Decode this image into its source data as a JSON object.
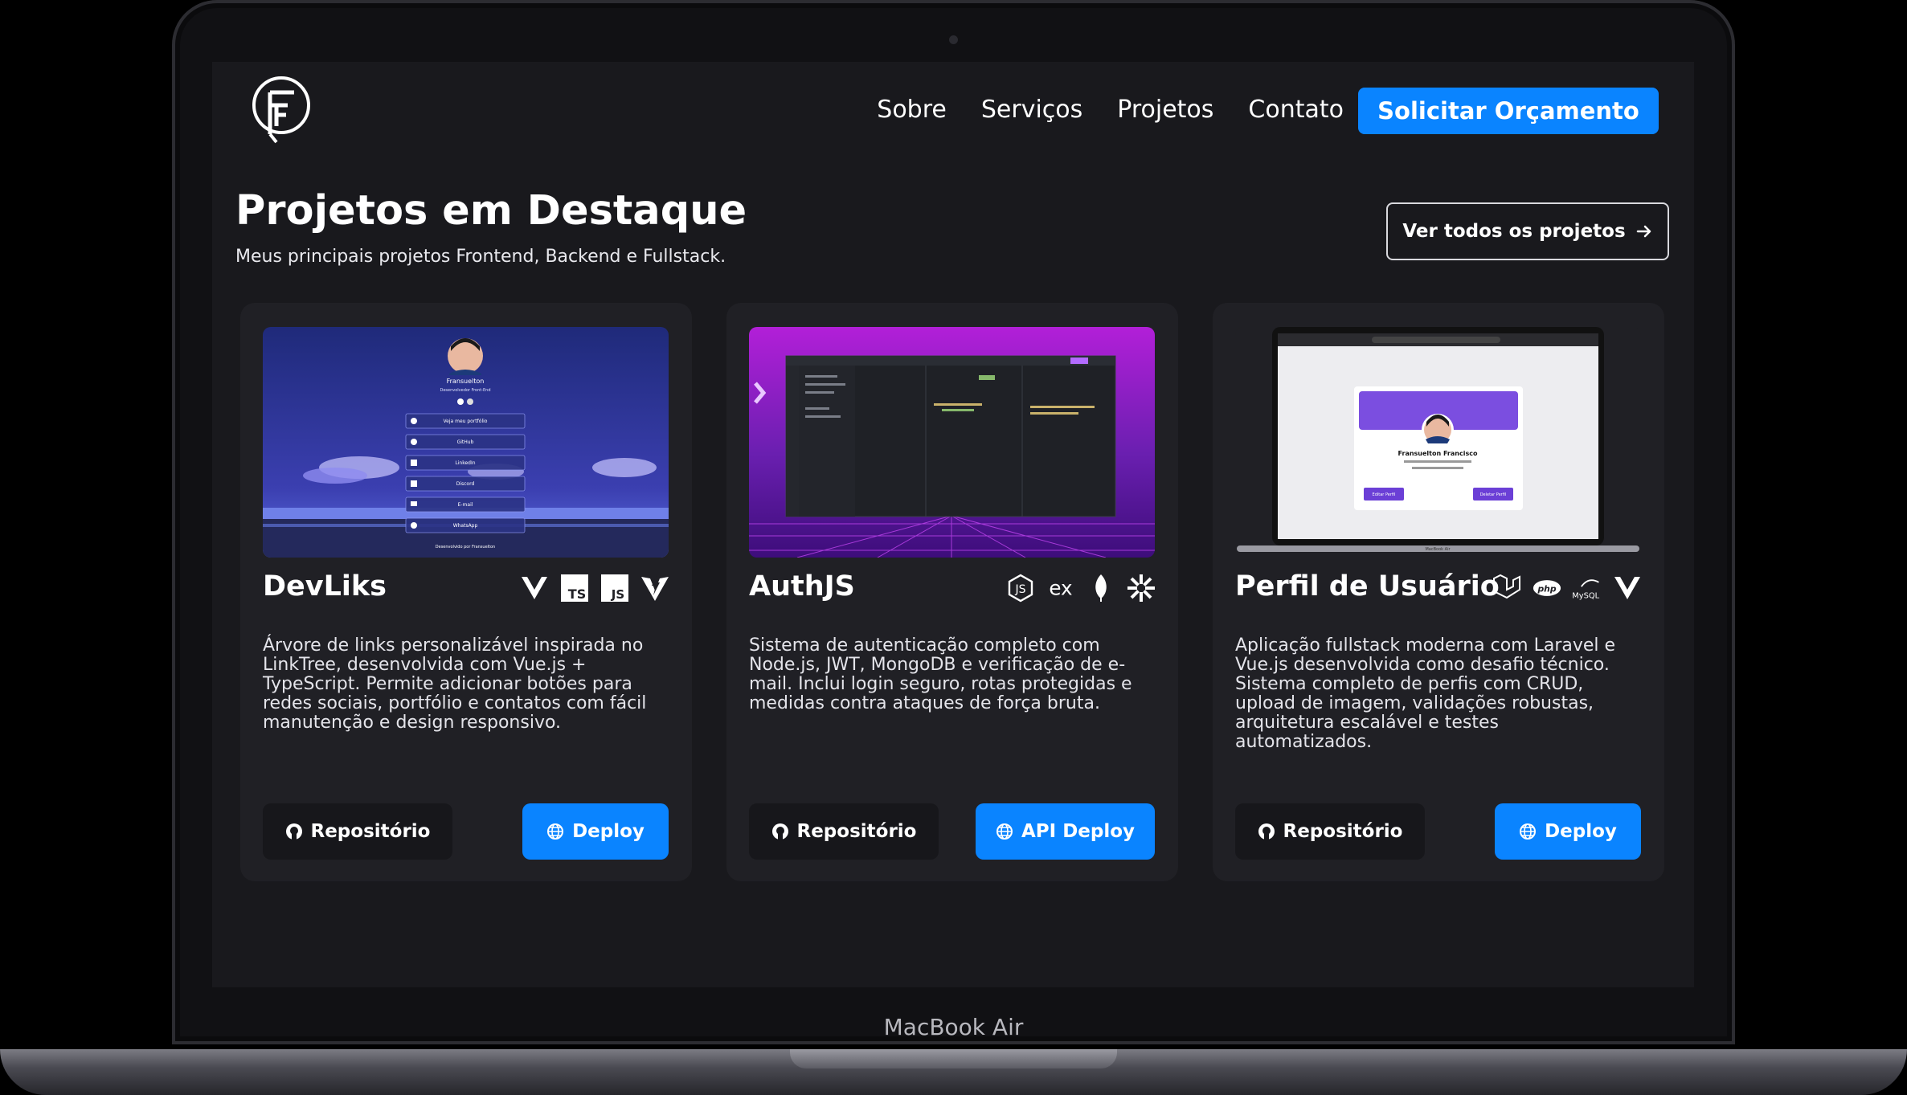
{
  "device": {
    "label": "MacBook Air"
  },
  "header": {
    "nav": [
      "Sobre",
      "Serviços",
      "Projetos",
      "Contato"
    ],
    "cta": "Solicitar Orçamento"
  },
  "section": {
    "title": "Projetos em Destaque",
    "subtitle": "Meus principais projetos Frontend, Backend e Fullstack.",
    "see_all": "Ver todos os projetos"
  },
  "projects": [
    {
      "title": "DevLiks",
      "tech_icons": [
        "vue-icon",
        "typescript-icon",
        "javascript-icon",
        "vite-icon"
      ],
      "description": "Árvore de links personalizável inspirada no LinkTree, desenvolvida com Vue.js + TypeScript. Permite adicionar botões para redes sociais, portfólio e contatos com fácil manutenção e design responsivo.",
      "repo_label": "Repositório",
      "deploy_label": "Deploy",
      "preview": {
        "name": "Fransuelton",
        "role": "Desenvolvedor Front-End",
        "links": [
          "Veja meu portfólio",
          "GitHub",
          "LinkedIn",
          "Discord",
          "E-mail",
          "WhatsApp"
        ],
        "footer": "Desenvolvido por Fransuelton"
      }
    },
    {
      "title": "AuthJS",
      "tech_icons": [
        "nodejs-icon",
        "express-icon",
        "mongodb-icon",
        "jwt-icon"
      ],
      "description": "Sistema de autenticação completo com Node.js, JWT, MongoDB e verificação de e-mail. Inclui login seguro, rotas protegidas e medidas contra ataques de força bruta.",
      "repo_label": "Repositório",
      "deploy_label": "API Deploy"
    },
    {
      "title": "Perfil de Usuário",
      "tech_icons": [
        "laravel-icon",
        "php-icon",
        "mysql-icon",
        "vue-icon"
      ],
      "description": "Aplicação fullstack moderna com Laravel e Vue.js desenvolvida como desafio técnico. Sistema completo de perfis com CRUD, upload de imagem, validações robustas, arquitetura escalável e testes automatizados.",
      "repo_label": "Repositório",
      "deploy_label": "Deploy",
      "preview": {
        "name": "Fransuelton Francisco",
        "edit": "Editar Perfil",
        "delete": "Deletar Perfil",
        "device": "MacBook Air"
      }
    }
  ],
  "colors": {
    "accent": "#0a84ff",
    "background": "#19191d",
    "card": "#202025"
  }
}
